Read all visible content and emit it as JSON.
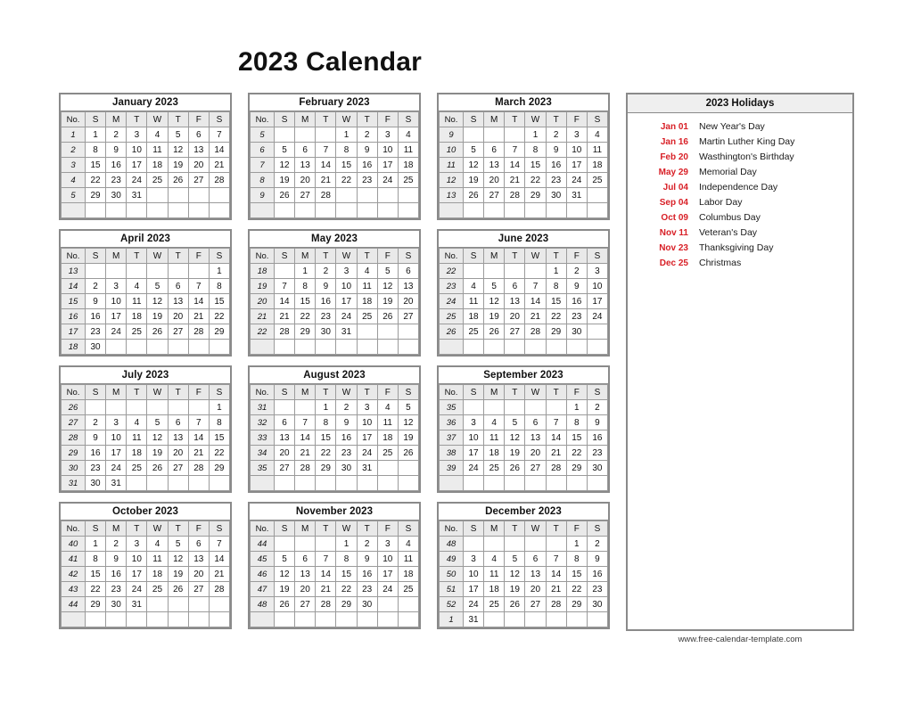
{
  "page": {
    "title": "2023 Calendar",
    "footer": "www.free-calendar-template.com",
    "accent_red": "#d81f26",
    "border_gray": "#8a8a8a",
    "header_fill": "#e9e9e9"
  },
  "weekday_headers": [
    "No.",
    "S",
    "M",
    "T",
    "W",
    "T",
    "F",
    "S"
  ],
  "months": [
    {
      "name": "January 2023",
      "weeks": [
        {
          "no": "1",
          "days": [
            "1",
            "2",
            "3",
            "4",
            "5",
            "6",
            "7"
          ]
        },
        {
          "no": "2",
          "days": [
            "8",
            "9",
            "10",
            "11",
            "12",
            "13",
            "14"
          ]
        },
        {
          "no": "3",
          "days": [
            "15",
            "16",
            "17",
            "18",
            "19",
            "20",
            "21"
          ]
        },
        {
          "no": "4",
          "days": [
            "22",
            "23",
            "24",
            "25",
            "26",
            "27",
            "28"
          ]
        },
        {
          "no": "5",
          "days": [
            "29",
            "30",
            "31",
            "",
            "",
            "",
            ""
          ]
        },
        {
          "no": "",
          "days": [
            "",
            "",
            "",
            "",
            "",
            "",
            ""
          ]
        }
      ]
    },
    {
      "name": "February 2023",
      "weeks": [
        {
          "no": "5",
          "days": [
            "",
            "",
            "",
            "1",
            "2",
            "3",
            "4"
          ]
        },
        {
          "no": "6",
          "days": [
            "5",
            "6",
            "7",
            "8",
            "9",
            "10",
            "11"
          ]
        },
        {
          "no": "7",
          "days": [
            "12",
            "13",
            "14",
            "15",
            "16",
            "17",
            "18"
          ]
        },
        {
          "no": "8",
          "days": [
            "19",
            "20",
            "21",
            "22",
            "23",
            "24",
            "25"
          ]
        },
        {
          "no": "9",
          "days": [
            "26",
            "27",
            "28",
            "",
            "",
            "",
            ""
          ]
        },
        {
          "no": "",
          "days": [
            "",
            "",
            "",
            "",
            "",
            "",
            ""
          ]
        }
      ]
    },
    {
      "name": "March 2023",
      "weeks": [
        {
          "no": "9",
          "days": [
            "",
            "",
            "",
            "1",
            "2",
            "3",
            "4"
          ]
        },
        {
          "no": "10",
          "days": [
            "5",
            "6",
            "7",
            "8",
            "9",
            "10",
            "11"
          ]
        },
        {
          "no": "11",
          "days": [
            "12",
            "13",
            "14",
            "15",
            "16",
            "17",
            "18"
          ]
        },
        {
          "no": "12",
          "days": [
            "19",
            "20",
            "21",
            "22",
            "23",
            "24",
            "25"
          ]
        },
        {
          "no": "13",
          "days": [
            "26",
            "27",
            "28",
            "29",
            "30",
            "31",
            ""
          ]
        },
        {
          "no": "",
          "days": [
            "",
            "",
            "",
            "",
            "",
            "",
            ""
          ]
        }
      ]
    },
    {
      "name": "April 2023",
      "weeks": [
        {
          "no": "13",
          "days": [
            "",
            "",
            "",
            "",
            "",
            "",
            "1"
          ]
        },
        {
          "no": "14",
          "days": [
            "2",
            "3",
            "4",
            "5",
            "6",
            "7",
            "8"
          ]
        },
        {
          "no": "15",
          "days": [
            "9",
            "10",
            "11",
            "12",
            "13",
            "14",
            "15"
          ]
        },
        {
          "no": "16",
          "days": [
            "16",
            "17",
            "18",
            "19",
            "20",
            "21",
            "22"
          ]
        },
        {
          "no": "17",
          "days": [
            "23",
            "24",
            "25",
            "26",
            "27",
            "28",
            "29"
          ]
        },
        {
          "no": "18",
          "days": [
            "30",
            "",
            "",
            "",
            "",
            "",
            ""
          ]
        }
      ]
    },
    {
      "name": "May 2023",
      "weeks": [
        {
          "no": "18",
          "days": [
            "",
            "1",
            "2",
            "3",
            "4",
            "5",
            "6"
          ]
        },
        {
          "no": "19",
          "days": [
            "7",
            "8",
            "9",
            "10",
            "11",
            "12",
            "13"
          ]
        },
        {
          "no": "20",
          "days": [
            "14",
            "15",
            "16",
            "17",
            "18",
            "19",
            "20"
          ]
        },
        {
          "no": "21",
          "days": [
            "21",
            "22",
            "23",
            "24",
            "25",
            "26",
            "27"
          ]
        },
        {
          "no": "22",
          "days": [
            "28",
            "29",
            "30",
            "31",
            "",
            "",
            ""
          ]
        },
        {
          "no": "",
          "days": [
            "",
            "",
            "",
            "",
            "",
            "",
            ""
          ]
        }
      ]
    },
    {
      "name": "June 2023",
      "weeks": [
        {
          "no": "22",
          "days": [
            "",
            "",
            "",
            "",
            "1",
            "2",
            "3"
          ]
        },
        {
          "no": "23",
          "days": [
            "4",
            "5",
            "6",
            "7",
            "8",
            "9",
            "10"
          ]
        },
        {
          "no": "24",
          "days": [
            "11",
            "12",
            "13",
            "14",
            "15",
            "16",
            "17"
          ]
        },
        {
          "no": "25",
          "days": [
            "18",
            "19",
            "20",
            "21",
            "22",
            "23",
            "24"
          ]
        },
        {
          "no": "26",
          "days": [
            "25",
            "26",
            "27",
            "28",
            "29",
            "30",
            ""
          ]
        },
        {
          "no": "",
          "days": [
            "",
            "",
            "",
            "",
            "",
            "",
            ""
          ]
        }
      ]
    },
    {
      "name": "July 2023",
      "weeks": [
        {
          "no": "26",
          "days": [
            "",
            "",
            "",
            "",
            "",
            "",
            "1"
          ]
        },
        {
          "no": "27",
          "days": [
            "2",
            "3",
            "4",
            "5",
            "6",
            "7",
            "8"
          ]
        },
        {
          "no": "28",
          "days": [
            "9",
            "10",
            "11",
            "12",
            "13",
            "14",
            "15"
          ]
        },
        {
          "no": "29",
          "days": [
            "16",
            "17",
            "18",
            "19",
            "20",
            "21",
            "22"
          ]
        },
        {
          "no": "30",
          "days": [
            "23",
            "24",
            "25",
            "26",
            "27",
            "28",
            "29"
          ]
        },
        {
          "no": "31",
          "days": [
            "30",
            "31",
            "",
            "",
            "",
            "",
            ""
          ]
        }
      ]
    },
    {
      "name": "August 2023",
      "weeks": [
        {
          "no": "31",
          "days": [
            "",
            "",
            "1",
            "2",
            "3",
            "4",
            "5"
          ]
        },
        {
          "no": "32",
          "days": [
            "6",
            "7",
            "8",
            "9",
            "10",
            "11",
            "12"
          ]
        },
        {
          "no": "33",
          "days": [
            "13",
            "14",
            "15",
            "16",
            "17",
            "18",
            "19"
          ]
        },
        {
          "no": "34",
          "days": [
            "20",
            "21",
            "22",
            "23",
            "24",
            "25",
            "26"
          ]
        },
        {
          "no": "35",
          "days": [
            "27",
            "28",
            "29",
            "30",
            "31",
            "",
            ""
          ]
        },
        {
          "no": "",
          "days": [
            "",
            "",
            "",
            "",
            "",
            "",
            ""
          ]
        }
      ]
    },
    {
      "name": "September 2023",
      "weeks": [
        {
          "no": "35",
          "days": [
            "",
            "",
            "",
            "",
            "",
            "1",
            "2"
          ]
        },
        {
          "no": "36",
          "days": [
            "3",
            "4",
            "5",
            "6",
            "7",
            "8",
            "9"
          ]
        },
        {
          "no": "37",
          "days": [
            "10",
            "11",
            "12",
            "13",
            "14",
            "15",
            "16"
          ]
        },
        {
          "no": "38",
          "days": [
            "17",
            "18",
            "19",
            "20",
            "21",
            "22",
            "23"
          ]
        },
        {
          "no": "39",
          "days": [
            "24",
            "25",
            "26",
            "27",
            "28",
            "29",
            "30"
          ]
        },
        {
          "no": "",
          "days": [
            "",
            "",
            "",
            "",
            "",
            "",
            ""
          ]
        }
      ]
    },
    {
      "name": "October 2023",
      "weeks": [
        {
          "no": "40",
          "days": [
            "1",
            "2",
            "3",
            "4",
            "5",
            "6",
            "7"
          ]
        },
        {
          "no": "41",
          "days": [
            "8",
            "9",
            "10",
            "11",
            "12",
            "13",
            "14"
          ]
        },
        {
          "no": "42",
          "days": [
            "15",
            "16",
            "17",
            "18",
            "19",
            "20",
            "21"
          ]
        },
        {
          "no": "43",
          "days": [
            "22",
            "23",
            "24",
            "25",
            "26",
            "27",
            "28"
          ]
        },
        {
          "no": "44",
          "days": [
            "29",
            "30",
            "31",
            "",
            "",
            "",
            ""
          ]
        },
        {
          "no": "",
          "days": [
            "",
            "",
            "",
            "",
            "",
            "",
            ""
          ]
        }
      ]
    },
    {
      "name": "November 2023",
      "weeks": [
        {
          "no": "44",
          "days": [
            "",
            "",
            "",
            "1",
            "2",
            "3",
            "4"
          ]
        },
        {
          "no": "45",
          "days": [
            "5",
            "6",
            "7",
            "8",
            "9",
            "10",
            "11"
          ]
        },
        {
          "no": "46",
          "days": [
            "12",
            "13",
            "14",
            "15",
            "16",
            "17",
            "18"
          ]
        },
        {
          "no": "47",
          "days": [
            "19",
            "20",
            "21",
            "22",
            "23",
            "24",
            "25"
          ]
        },
        {
          "no": "48",
          "days": [
            "26",
            "27",
            "28",
            "29",
            "30",
            "",
            ""
          ]
        },
        {
          "no": "",
          "days": [
            "",
            "",
            "",
            "",
            "",
            "",
            ""
          ]
        }
      ]
    },
    {
      "name": "December 2023",
      "weeks": [
        {
          "no": "48",
          "days": [
            "",
            "",
            "",
            "",
            "",
            "1",
            "2"
          ]
        },
        {
          "no": "49",
          "days": [
            "3",
            "4",
            "5",
            "6",
            "7",
            "8",
            "9"
          ]
        },
        {
          "no": "50",
          "days": [
            "10",
            "11",
            "12",
            "13",
            "14",
            "15",
            "16"
          ]
        },
        {
          "no": "51",
          "days": [
            "17",
            "18",
            "19",
            "20",
            "21",
            "22",
            "23"
          ]
        },
        {
          "no": "52",
          "days": [
            "24",
            "25",
            "26",
            "27",
            "28",
            "29",
            "30"
          ]
        },
        {
          "no": "1",
          "days": [
            "31",
            "",
            "",
            "",
            "",
            "",
            ""
          ]
        }
      ]
    }
  ],
  "holidays": {
    "title": "2023 Holidays",
    "items": [
      {
        "date": "Jan 01",
        "name": "New Year's Day"
      },
      {
        "date": "Jan 16",
        "name": "Martin Luther King Day"
      },
      {
        "date": "Feb 20",
        "name": "Wasthington's Birthday"
      },
      {
        "date": "May 29",
        "name": "Memorial Day"
      },
      {
        "date": "Jul 04",
        "name": "Independence Day"
      },
      {
        "date": "Sep 04",
        "name": "Labor Day"
      },
      {
        "date": "Oct 09",
        "name": "Columbus Day"
      },
      {
        "date": "Nov 11",
        "name": "Veteran's Day"
      },
      {
        "date": "Nov 23",
        "name": "Thanksgiving Day"
      },
      {
        "date": "Dec 25",
        "name": "Christmas"
      }
    ]
  }
}
